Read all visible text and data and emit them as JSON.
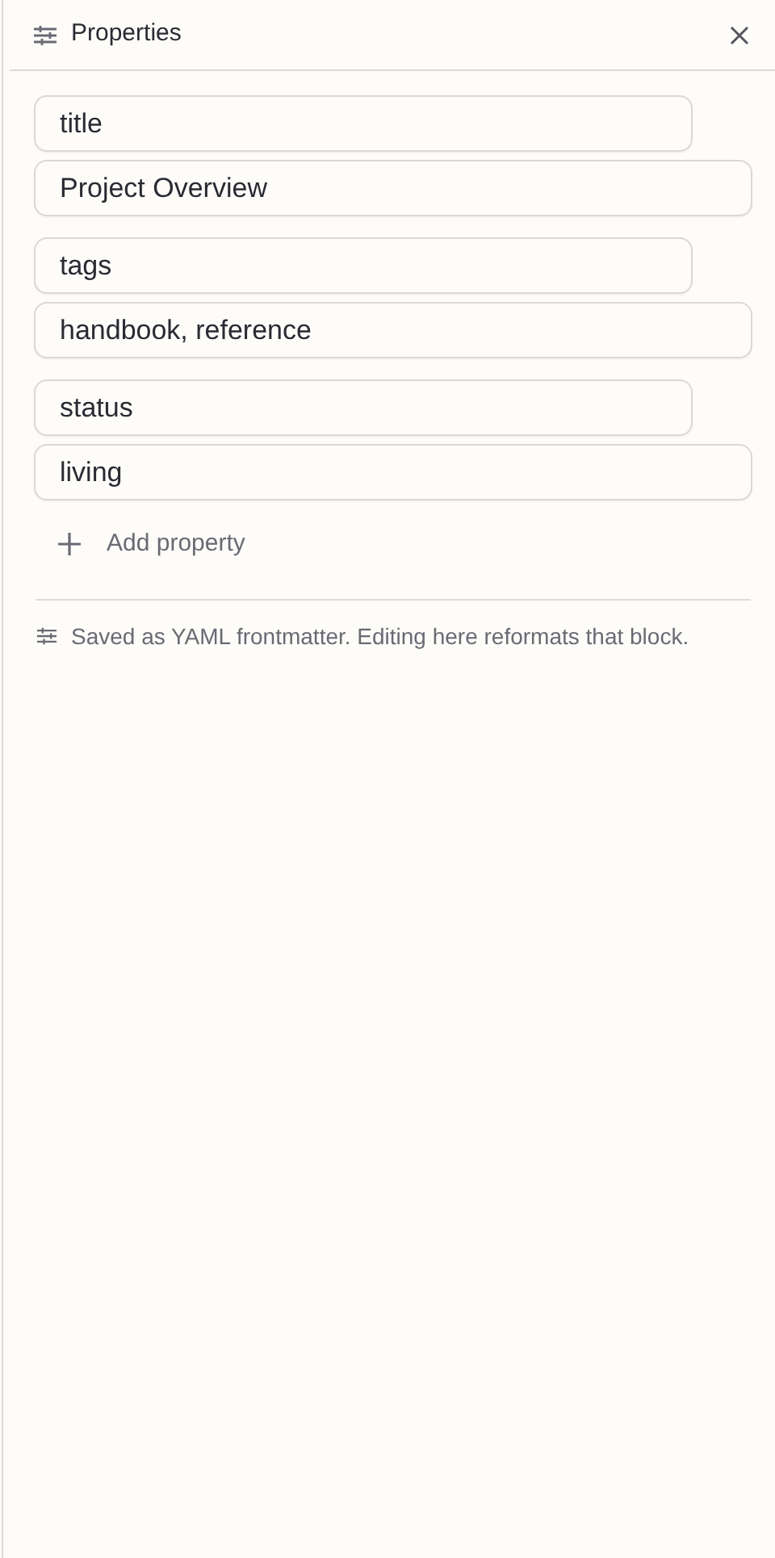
{
  "panel": {
    "title": "Properties"
  },
  "properties": [
    {
      "key": "title",
      "value": "Project Overview"
    },
    {
      "key": "tags",
      "value": "handbook, reference"
    },
    {
      "key": "status",
      "value": "living"
    }
  ],
  "add_button": {
    "label": "Add property"
  },
  "footer_note": "Saved as YAML frontmatter. Editing here reformats that block."
}
